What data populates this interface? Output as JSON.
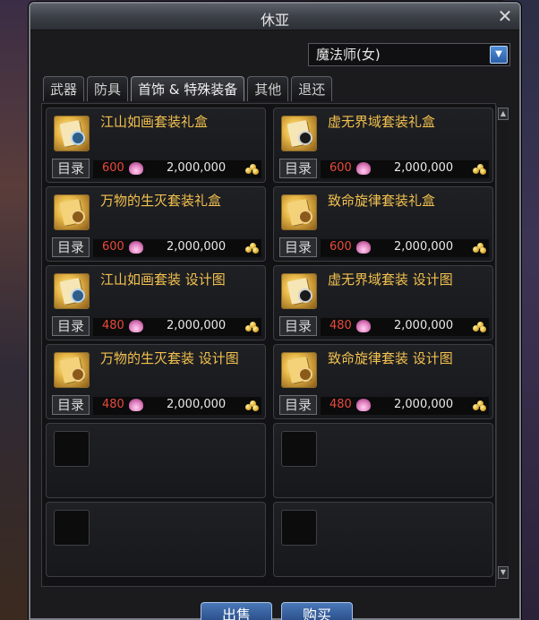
{
  "window": {
    "title": "休亚",
    "close_symbol": "✕"
  },
  "class_select": {
    "value": "魔法师(女)",
    "arrow": "▼"
  },
  "tabs": [
    {
      "label": "武器",
      "active": false
    },
    {
      "label": "防具",
      "active": false
    },
    {
      "label": "首饰 & 特殊装备",
      "active": true
    },
    {
      "label": "其他",
      "active": false
    },
    {
      "label": "退还",
      "active": false
    }
  ],
  "catalog_label": "目录",
  "items": [
    {
      "name": "江山如画套装礼盒",
      "cert_price": "600",
      "gold_price": "2,000,000",
      "icon": "scroll-blue-seal-icon"
    },
    {
      "name": "虚无界域套装礼盒",
      "cert_price": "600",
      "gold_price": "2,000,000",
      "icon": "scroll-dark-seal-icon"
    },
    {
      "name": "万物的生灭套装礼盒",
      "cert_price": "600",
      "gold_price": "2,000,000",
      "icon": "scroll-swirl-icon"
    },
    {
      "name": "致命旋律套装礼盒",
      "cert_price": "600",
      "gold_price": "2,000,000",
      "icon": "scroll-swirl-icon"
    },
    {
      "name": "江山如画套装  设计图",
      "cert_price": "480",
      "gold_price": "2,000,000",
      "icon": "scroll-blue-seal-icon"
    },
    {
      "name": "虚无界域套装  设计图",
      "cert_price": "480",
      "gold_price": "2,000,000",
      "icon": "scroll-dark-seal-icon"
    },
    {
      "name": "万物的生灭套装  设计图",
      "cert_price": "480",
      "gold_price": "2,000,000",
      "icon": "scroll-swirl-icon"
    },
    {
      "name": "致命旋律套装  设计图",
      "cert_price": "480",
      "gold_price": "2,000,000",
      "icon": "scroll-swirl-icon"
    }
  ],
  "scroll": {
    "up": "▲",
    "down": "▼"
  },
  "buttons": {
    "sell": "出售",
    "buy": "购买"
  }
}
